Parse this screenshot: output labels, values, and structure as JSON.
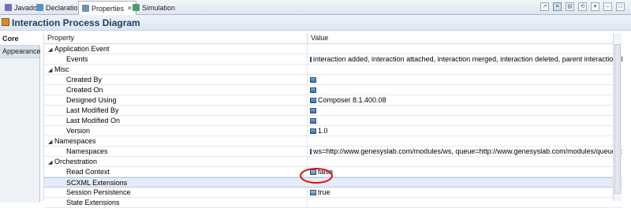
{
  "tabs": [
    {
      "label": "Javadoc",
      "active": false,
      "icon": "javadoc-icon"
    },
    {
      "label": "Declaration",
      "active": false,
      "icon": "declaration-icon"
    },
    {
      "label": "Properties",
      "active": true,
      "icon": "properties-icon",
      "close": "✕"
    },
    {
      "label": "Simulation",
      "active": false,
      "icon": "simulation-icon"
    }
  ],
  "header": {
    "title": "Interaction Process Diagram"
  },
  "left_tabs": [
    {
      "label": "Core",
      "active": true
    },
    {
      "label": "Appearance",
      "active": false
    }
  ],
  "columns": {
    "property": "Property",
    "value": "Value"
  },
  "rows": [
    {
      "kind": "category",
      "label": "Application Event"
    },
    {
      "kind": "child",
      "label": "Events",
      "value": "interaction added, interaction attached, interaction merged, interaction deleted, parent interaction deleted, inte"
    },
    {
      "kind": "category",
      "label": "Misc"
    },
    {
      "kind": "child",
      "label": "Created By",
      "value": ""
    },
    {
      "kind": "child",
      "label": "Created On",
      "value": ""
    },
    {
      "kind": "child",
      "label": "Designed Using",
      "value": "Composer 8.1.400.08"
    },
    {
      "kind": "child",
      "label": "Last Modified By",
      "value": ""
    },
    {
      "kind": "child",
      "label": "Last Modified On",
      "value": ""
    },
    {
      "kind": "child",
      "label": "Version",
      "value": "1.0"
    },
    {
      "kind": "category",
      "label": "Namespaces"
    },
    {
      "kind": "child",
      "label": "Namespaces",
      "value": "ws=http://www.genesyslab.com/modules/ws, queue=http://www.genesyslab.com/modules/queue, dialog=h"
    },
    {
      "kind": "category",
      "label": "Orchestration"
    },
    {
      "kind": "child",
      "label": "Read Context",
      "value": "false"
    },
    {
      "kind": "child",
      "label": "SCXML Extensions",
      "value": "",
      "selected": true
    },
    {
      "kind": "child",
      "label": "Session Persistence",
      "value": "true"
    },
    {
      "kind": "child",
      "label": "State Extensions",
      "value": ""
    }
  ]
}
